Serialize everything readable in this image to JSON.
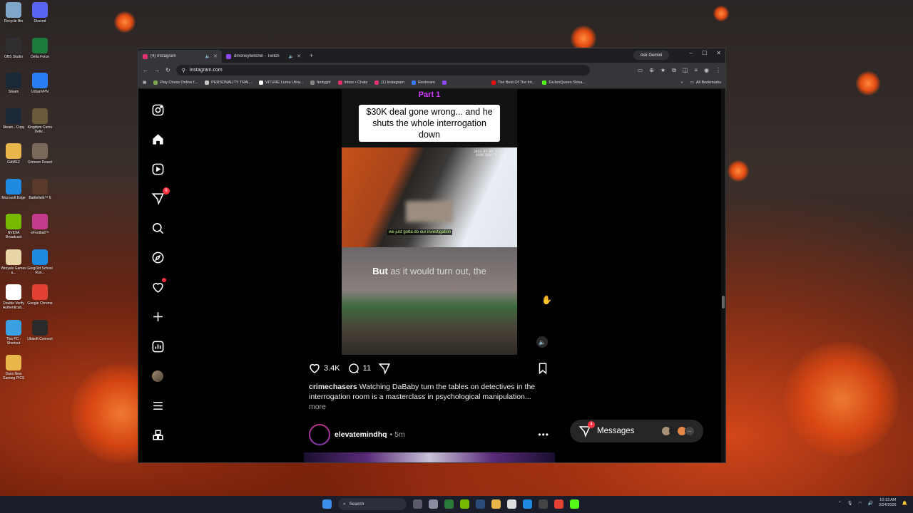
{
  "desktop": {
    "icons": [
      {
        "label": "Recycle Bin",
        "color": "#7fa7c9"
      },
      {
        "label": "Discord",
        "color": "#5865f2"
      },
      {
        "label": "OBS Studio",
        "color": "#302e31"
      },
      {
        "label": "Delta Force",
        "color": "#1c7a3a"
      },
      {
        "label": "Steam",
        "color": "#1b2838"
      },
      {
        "label": "UrbanVPN",
        "color": "#2a7cf7"
      },
      {
        "label": "Steam - Copy",
        "color": "#1b2838"
      },
      {
        "label": "Kingdom Come Deliv...",
        "color": "#6b5a3a"
      },
      {
        "label": "GAMEZ",
        "color": "#e8b64a"
      },
      {
        "label": "Crimson Desert",
        "color": "#7a6a5a"
      },
      {
        "label": "Microsoft Edge",
        "color": "#1f8ae0"
      },
      {
        "label": "Battlefield™ 6",
        "color": "#5a3a2a"
      },
      {
        "label": "NVIDIA Broadcast",
        "color": "#76b900"
      },
      {
        "label": "eFootball™",
        "color": "#c23a8a"
      },
      {
        "label": "Wroyals Games a...",
        "color": "#e8d6a8"
      },
      {
        "label": "GregOld School Run...",
        "color": "#1f8ae0"
      },
      {
        "label": "Double Verify Authenticati...",
        "color": "#ffffff"
      },
      {
        "label": "Google Chrome",
        "color": "#e34133"
      },
      {
        "label": "This PC - Shortcut",
        "color": "#3aa0e0"
      },
      {
        "label": "Ubisoft Connect",
        "color": "#2a2a2a"
      },
      {
        "label": "Dans New Gaming PICS",
        "color": "#e8b64a"
      }
    ]
  },
  "browser": {
    "tabs": [
      {
        "title": "(4) Instagram",
        "active": true,
        "fav_color": "#e1306c"
      },
      {
        "title": "dmoneytwitchin - Twitch",
        "active": false,
        "fav_color": "#9146ff"
      }
    ],
    "new_tab_icon": "plus-icon",
    "gemini_label": "Ask Gemini",
    "url": "instagram.com",
    "bookmarks": [
      {
        "label": "Play Chess Online f...",
        "color": "#7fa650"
      },
      {
        "label": "PERSONALITY TRAI...",
        "color": "#c8c8c8"
      },
      {
        "label": "VITURE Luma Ultra...",
        "color": "#ffffff"
      },
      {
        "label": "fentygirl",
        "color": "#888888"
      },
      {
        "label": "Inbox • Chats",
        "color": "#e1306c"
      },
      {
        "label": "(1) Instagram",
        "color": "#e1306c"
      },
      {
        "label": "Restream",
        "color": "#3a7cff"
      },
      {
        "label": "",
        "color": "#9146ff"
      },
      {
        "label": "The Best Of The Int...",
        "color": "#ff0000"
      },
      {
        "label": "DeJenQueen Strea...",
        "color": "#53fc18"
      }
    ],
    "all_bookmarks_label": "All Bookmarks"
  },
  "instagram": {
    "nav": [
      {
        "name": "instagram-logo-icon",
        "badge": ""
      },
      {
        "name": "home-icon",
        "badge": ""
      },
      {
        "name": "reels-icon",
        "badge": ""
      },
      {
        "name": "messages-icon",
        "badge": "6"
      },
      {
        "name": "search-icon",
        "badge": ""
      },
      {
        "name": "explore-icon",
        "badge": ""
      },
      {
        "name": "notifications-icon",
        "badge": "dot"
      },
      {
        "name": "create-icon",
        "badge": ""
      },
      {
        "name": "dashboard-icon",
        "badge": ""
      },
      {
        "name": "profile-avatar",
        "badge": ""
      },
      {
        "name": "menu-icon",
        "badge": ""
      },
      {
        "name": "also-from-meta-icon",
        "badge": ""
      }
    ],
    "post": {
      "part_label": "Part 1",
      "overlay_title": "$30K deal gone wrong... and he shuts the whole interrogation down",
      "bodycam_text": "2024-07-09 T22:10:162\nAXON BODY 2 X81614Z0",
      "subtitle": "we just gotta do our investigation",
      "caption_lead": "But",
      "caption_rest": " as it would turn out, the",
      "likes": "3.4K",
      "comments": "11",
      "username": "crimechasers",
      "caption": "Watching DaBaby turn the tables on detectives in the interrogation room is a masterclass in psychological manipulation...",
      "more_label": "more"
    },
    "next_post": {
      "username": "elevatemindhq",
      "time": "5m"
    },
    "messages": {
      "label": "Messages",
      "badge": "4",
      "avatar_colors": [
        "#a89276",
        "#222222",
        "#e8874a"
      ]
    }
  },
  "taskbar": {
    "search_label": "Search",
    "time": "10:13 AM",
    "date": "3/24/2026",
    "apps": [
      {
        "name": "file-manager-icon",
        "color": "#5a5a6a"
      },
      {
        "name": "settings-icon",
        "color": "#8a8aa0"
      },
      {
        "name": "terminal-icon",
        "color": "#2a7a3a"
      },
      {
        "name": "nvidia-icon",
        "color": "#76b900"
      },
      {
        "name": "steam-icon",
        "color": "#2a4a7a"
      },
      {
        "name": "folder-icon",
        "color": "#e8b64a"
      },
      {
        "name": "notes-icon",
        "color": "#dddddd"
      },
      {
        "name": "edge-icon",
        "color": "#1f8ae0"
      },
      {
        "name": "obs-icon",
        "color": "#444444"
      },
      {
        "name": "chrome-icon",
        "color": "#e34133"
      },
      {
        "name": "gamebar-icon",
        "color": "#53fc18"
      }
    ]
  }
}
